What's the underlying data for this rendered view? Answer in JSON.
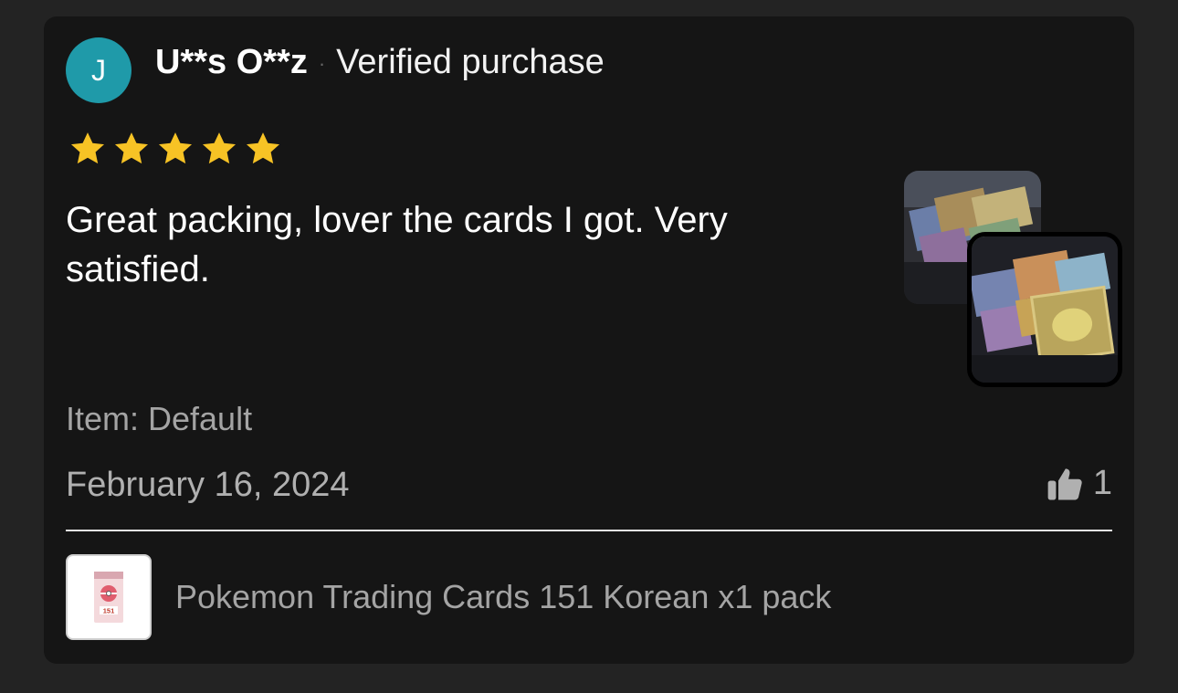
{
  "review": {
    "avatar_initial": "J",
    "reviewer_name": "U**s O**z",
    "separator": "·",
    "badge": "Verified purchase",
    "rating": 5,
    "star_color": "#f7c325",
    "text": "Great packing, lover the cards I got. Very satisfied.",
    "item_variant": "Item: Default",
    "date": "February 16, 2024",
    "helpful_count": "1",
    "photos": [
      "photo-of-pokemon-cards",
      "photo-of-pokemon-cards"
    ]
  },
  "product": {
    "name": "Pokemon Trading Cards 151 Korean x1 pack",
    "thumb_icon": "pokemon-151-booster-pack"
  },
  "colors": {
    "background": "#232323",
    "card": "#151515",
    "avatar": "#1f9aa9",
    "muted_text": "#a4a4a4"
  }
}
